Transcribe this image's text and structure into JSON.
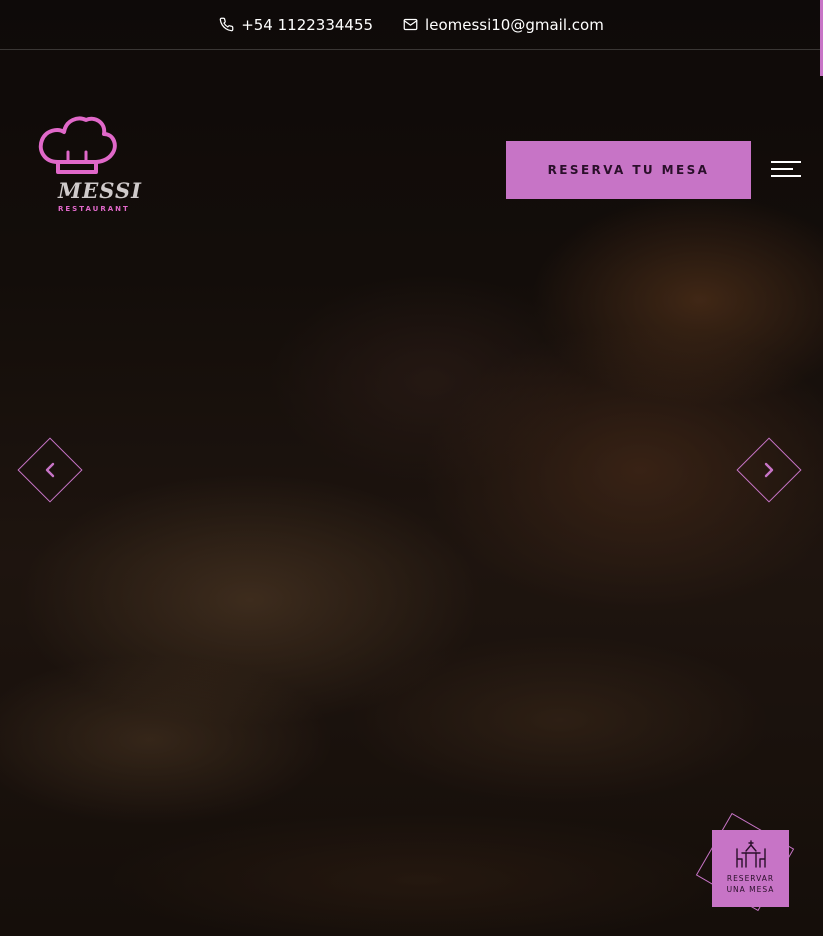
{
  "header": {
    "phone": "+54 1122334455",
    "email": "leomessi10@gmail.com",
    "phone_icon": "phone-icon",
    "email_icon": "mail-icon"
  },
  "logo": {
    "name": "MESSI",
    "subtitle": "RESTAURANT",
    "icon": "chef-hat-icon"
  },
  "nav": {
    "reserve_label": "RESERVA TU MESA",
    "menu_icon": "hamburger-menu-icon"
  },
  "slider": {
    "prev_icon": "chevron-left-icon",
    "next_icon": "chevron-right-icon"
  },
  "floating": {
    "line1": "RESERVAR",
    "line2": "UNA MESA",
    "icon": "dining-table-icon"
  },
  "colors": {
    "accent": "#c774c6",
    "logo_pink": "#e068c9",
    "background": "#0d0a09"
  }
}
